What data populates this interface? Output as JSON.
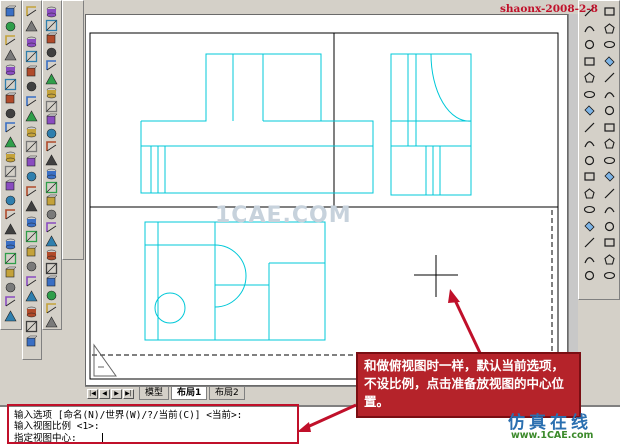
{
  "watermark": {
    "top_right": "shaonx-2008-2-8",
    "center": "1CAE.COM",
    "logo_cn": "仿真在线",
    "logo_url": "www.1CAE.com"
  },
  "layout_tabs": {
    "nav": [
      "|◀",
      "◀",
      "▶",
      "▶|"
    ],
    "tabs": [
      {
        "label": "模型",
        "active": false
      },
      {
        "label": "布局1",
        "active": true
      },
      {
        "label": "布局2",
        "active": false
      }
    ]
  },
  "command_line": {
    "line1": "输入选项 [命名(N)/世界(W)/?/当前(C)] <当前>:",
    "line2": "输入视图比例 <1>:",
    "line3": "指定视图中心:"
  },
  "callout": {
    "text": "和做俯视图时一样，默认当前选项，不设比例，点击准备放视图的中心位置。"
  },
  "colors": {
    "drawing_lines": "#00c8d8",
    "callout_bg": "#b5232a",
    "arrow": "#c0102a"
  },
  "toolbars": {
    "left_col1": [
      "ucs-icon",
      "world-ucs-icon",
      "object-ucs-icon",
      "face-ucs-icon",
      "view-ucs-icon",
      "origin-ucs-icon",
      "zaxis-ucs-icon",
      "3point-ucs-icon",
      "x-rotate-ucs-icon",
      "y-rotate-ucs-icon",
      "z-rotate-ucs-icon",
      "apply-ucs-icon",
      "named-ucs-icon",
      "prev-ucs-icon",
      "ucs-ii-icon",
      "layout-icon",
      "view-icon",
      "setup-icon",
      "profile-icon",
      "drawing-icon",
      "solid-icon",
      "interfere-icon"
    ],
    "left_col2": [
      "front-view-icon",
      "top-view-icon",
      "bottom-view-icon",
      "left-view-icon",
      "right-view-icon",
      "sw-iso-icon",
      "se-iso-icon",
      "ne-iso-icon",
      "nw-iso-icon",
      "box-icon",
      "wedge-icon",
      "cone-icon",
      "sphere-icon",
      "cylinder-icon",
      "torus-icon",
      "extrude-icon",
      "revolve-icon",
      "slice-icon",
      "section-icon",
      "interference-icon",
      "setup-drawing-icon",
      "setup-view-icon",
      "setup-profile-icon"
    ],
    "left_col3": [
      "3d-orbit-icon",
      "continuous-orbit-icon",
      "swivel-icon",
      "sphere-shade-icon",
      "cylinder-shade-icon",
      "cone-shade-icon",
      "torus-shade-icon",
      "dish-icon",
      "dome-icon",
      "mesh-icon",
      "extrude-face-icon",
      "move-face-icon",
      "offset-face-icon",
      "delete-face-icon",
      "rotate-face-icon",
      "taper-face-icon",
      "copy-face-icon",
      "color-face-icon",
      "copy-edge-icon",
      "imprint-icon",
      "clean-icon",
      "separate-icon",
      "shell-icon",
      "check-icon"
    ],
    "right_col": [
      "line-icon",
      "construction-line-icon",
      "polyline-icon",
      "polygon-icon",
      "rectangle-icon",
      "arc-icon",
      "circle-icon",
      "revcloud-icon",
      "spline-icon",
      "ellipse-icon",
      "ellipse-arc-icon",
      "insert-block-icon",
      "make-block-icon",
      "point-icon",
      "hatch-icon",
      "region-icon",
      "table-icon",
      "multiline-text-icon",
      "erase-icon",
      "copy-icon",
      "mirror-icon",
      "offset-icon",
      "array-icon",
      "move-icon",
      "rotate-icon",
      "scale-icon",
      "stretch-icon",
      "trim-icon",
      "extend-icon",
      "break-icon",
      "join-icon",
      "chamfer-icon",
      "fillet-icon",
      "explode-icon"
    ]
  }
}
